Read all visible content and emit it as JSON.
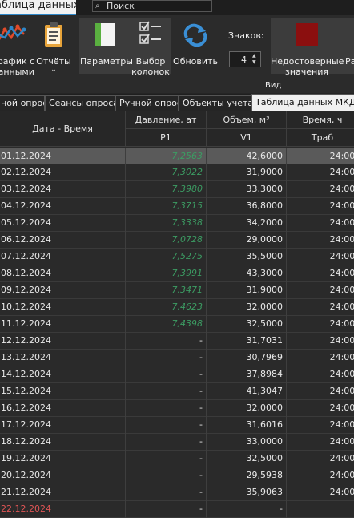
{
  "window": {
    "title": "Таблица данных"
  },
  "search": {
    "placeholder": "Поиск"
  },
  "ribbon": {
    "chart_btn": [
      "График с",
      "данными"
    ],
    "reports_btn": "Отчёты",
    "params_btn": "Параметры",
    "columns_btn": [
      "Выбор",
      "колонок"
    ],
    "refresh_btn": "Обновить",
    "digits_label": "Знаков:",
    "digits_value": "4",
    "unreliable_btn": [
      "Недостоверные",
      "значения"
    ],
    "extra_btn": "Ра",
    "group_label": "Вид"
  },
  "tabs": [
    "ной опрос",
    "Сеансы опроса",
    "Ручной опрос",
    "Объекты учета",
    "Таблица данных МКД Н"
  ],
  "columns": {
    "date": "Дата - Время",
    "pressure": "Давление, ат",
    "volume": "Объем, м³",
    "time": "Время, ч",
    "pressure_sub": "P1",
    "volume_sub": "V1",
    "time_sub": "Траб"
  },
  "rows": [
    {
      "date": "01.12.2024",
      "p": "7,2563",
      "v": "42,6000",
      "t": "24:00:"
    },
    {
      "date": "02.12.2024",
      "p": "7,3022",
      "v": "31,9000",
      "t": "24:00:"
    },
    {
      "date": "03.12.2024",
      "p": "7,3980",
      "v": "33,3000",
      "t": "24:00:"
    },
    {
      "date": "04.12.2024",
      "p": "7,3715",
      "v": "36,8000",
      "t": "24:00:"
    },
    {
      "date": "05.12.2024",
      "p": "7,3338",
      "v": "34,2000",
      "t": "24:00:"
    },
    {
      "date": "06.12.2024",
      "p": "7,0728",
      "v": "29,0000",
      "t": "24:00:"
    },
    {
      "date": "07.12.2024",
      "p": "7,5275",
      "v": "35,5000",
      "t": "24:00:"
    },
    {
      "date": "08.12.2024",
      "p": "7,3991",
      "v": "43,3000",
      "t": "24:00:"
    },
    {
      "date": "09.12.2024",
      "p": "7,3471",
      "v": "31,9000",
      "t": "24:00:"
    },
    {
      "date": "10.12.2024",
      "p": "7,4623",
      "v": "32,0000",
      "t": "24:00:"
    },
    {
      "date": "11.12.2024",
      "p": "7,4398",
      "v": "32,5000",
      "t": "24:00:"
    },
    {
      "date": "12.12.2024",
      "p": "-",
      "v": "31,7031",
      "t": "24:00:"
    },
    {
      "date": "13.12.2024",
      "p": "-",
      "v": "30,7969",
      "t": "24:00:"
    },
    {
      "date": "14.12.2024",
      "p": "-",
      "v": "37,8984",
      "t": "24:00:"
    },
    {
      "date": "15.12.2024",
      "p": "-",
      "v": "41,3047",
      "t": "24:00:"
    },
    {
      "date": "16.12.2024",
      "p": "-",
      "v": "32,0000",
      "t": "24:00:"
    },
    {
      "date": "17.12.2024",
      "p": "-",
      "v": "31,6016",
      "t": "24:00:"
    },
    {
      "date": "18.12.2024",
      "p": "-",
      "v": "33,0000",
      "t": "24:00:"
    },
    {
      "date": "19.12.2024",
      "p": "-",
      "v": "32,5000",
      "t": "24:00:"
    },
    {
      "date": "20.12.2024",
      "p": "-",
      "v": "29,5938",
      "t": "24:00:"
    },
    {
      "date": "21.12.2024",
      "p": "-",
      "v": "35,9063",
      "t": "24:00:"
    },
    {
      "date": "22.12.2024",
      "p": "-",
      "v": "-",
      "t": ""
    }
  ],
  "colors": {
    "accent": "#2e87c8",
    "green_value": "#3c9c63",
    "red_date": "#e05555",
    "unreliable_icon": "#8b0f0f"
  }
}
